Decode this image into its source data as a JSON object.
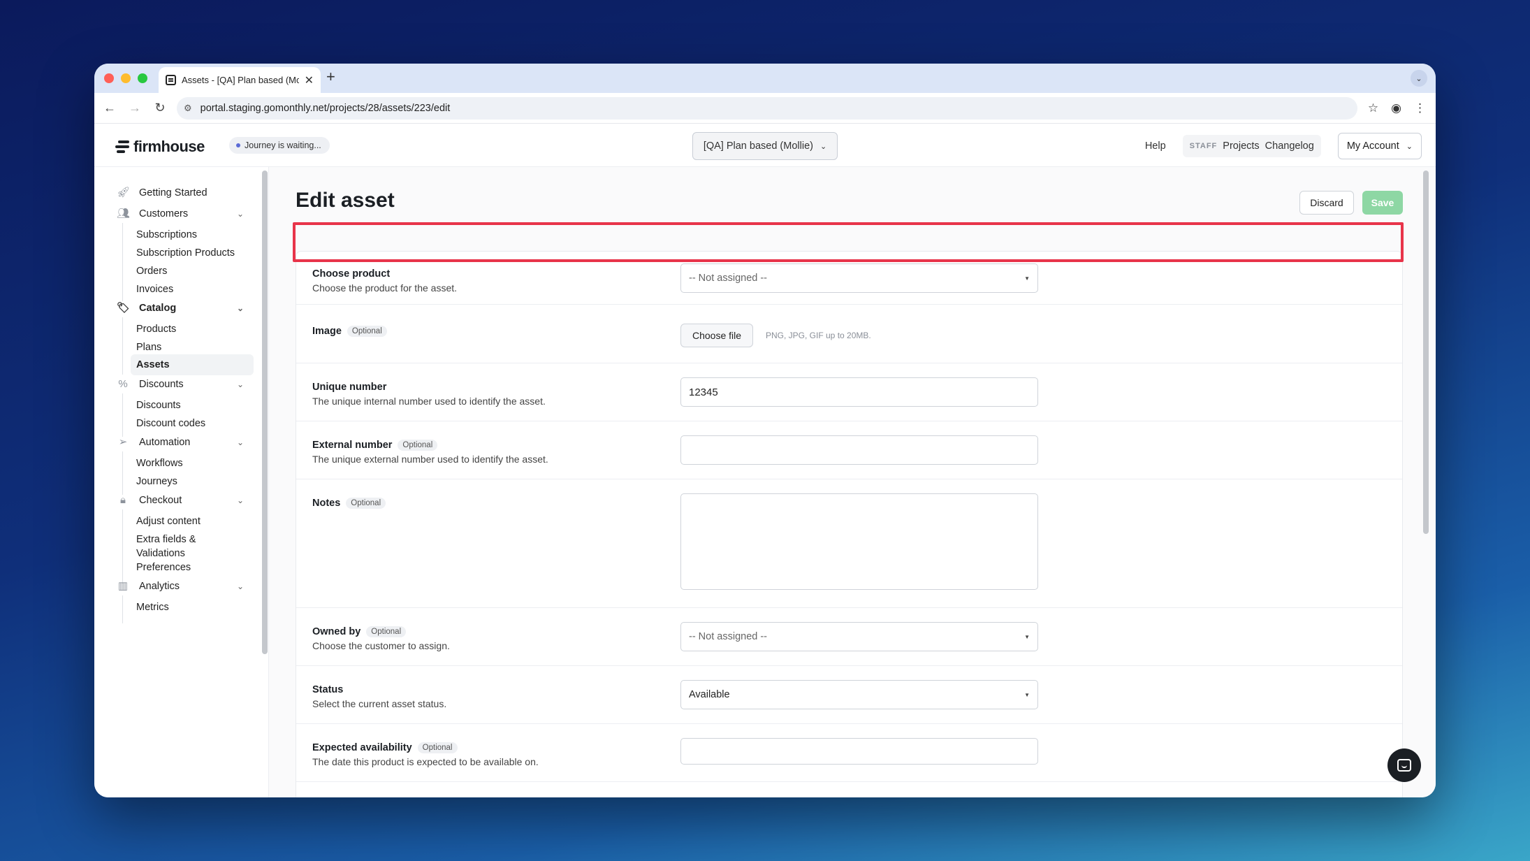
{
  "browser": {
    "tab_title": "Assets - [QA] Plan based (Mc",
    "url": "portal.staging.gomonthly.net/projects/28/assets/223/edit"
  },
  "header": {
    "logo": "firmhouse",
    "journey_badge": "Journey is waiting...",
    "project_selector": "[QA] Plan based (Mollie)",
    "help": "Help",
    "staff": "STAFF",
    "projects": "Projects",
    "changelog": "Changelog",
    "account": "My Account"
  },
  "sidebar": {
    "getting_started": "Getting Started",
    "customers": "Customers",
    "customers_items": [
      "Subscriptions",
      "Subscription Products",
      "Orders",
      "Invoices"
    ],
    "catalog": "Catalog",
    "catalog_items": [
      "Products",
      "Plans",
      "Assets"
    ],
    "discounts": "Discounts",
    "discounts_items": [
      "Discounts",
      "Discount codes"
    ],
    "automation": "Automation",
    "automation_items": [
      "Workflows",
      "Journeys"
    ],
    "checkout": "Checkout",
    "checkout_items": [
      "Adjust content",
      "Extra fields &",
      "Validations",
      "Preferences"
    ],
    "analytics": "Analytics",
    "analytics_items": [
      "Metrics"
    ]
  },
  "page": {
    "title": "Edit asset",
    "discard": "Discard",
    "save": "Save"
  },
  "form": {
    "optional": "Optional",
    "product": {
      "label": "Choose product",
      "desc": "Choose the product for the asset.",
      "value": "-- Not assigned --"
    },
    "image": {
      "label": "Image",
      "button": "Choose file",
      "hint": "PNG, JPG, GIF up to 20MB."
    },
    "unique_number": {
      "label": "Unique number",
      "desc": "The unique internal number used to identify the asset.",
      "value": "12345"
    },
    "external_number": {
      "label": "External number",
      "desc": "The unique external number used to identify the asset.",
      "value": ""
    },
    "notes": {
      "label": "Notes",
      "value": ""
    },
    "owned_by": {
      "label": "Owned by",
      "desc": "Choose the customer to assign.",
      "value": "-- Not assigned --"
    },
    "status": {
      "label": "Status",
      "desc": "Select the current asset status.",
      "value": "Available"
    },
    "expected": {
      "label": "Expected availability",
      "desc": "The date this product is expected to be available on.",
      "value": ""
    }
  },
  "colors": {
    "highlight": "#e8344a",
    "save_button": "#8ed7a4"
  }
}
